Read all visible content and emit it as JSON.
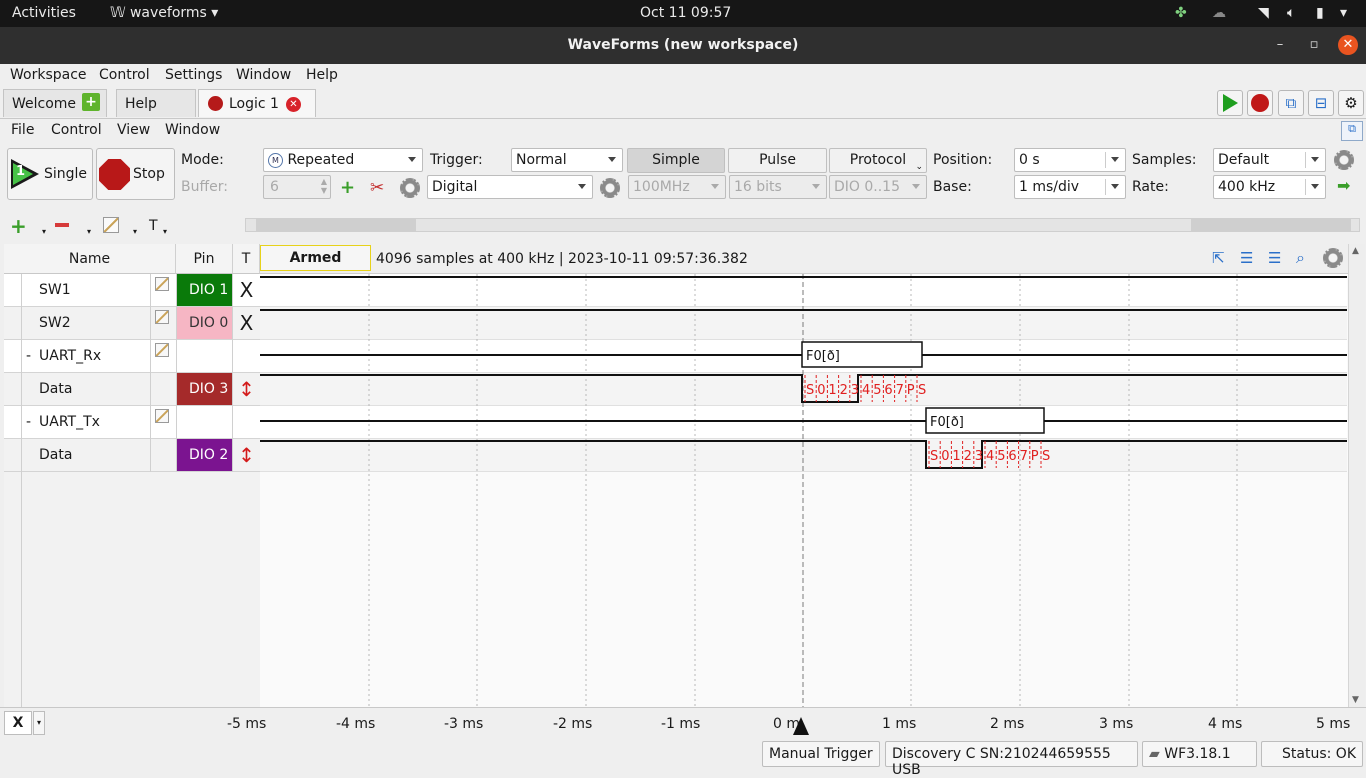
{
  "system_bar": {
    "activities": "Activities",
    "app": "waveforms",
    "clock": "Oct 11  09:57"
  },
  "window": {
    "title": "WaveForms (new workspace)"
  },
  "menu": [
    "Workspace",
    "Control",
    "Settings",
    "Window",
    "Help"
  ],
  "tabs": {
    "welcome": "Welcome",
    "help": "Help",
    "logic": "Logic 1"
  },
  "submenu": [
    "File",
    "Control",
    "View",
    "Window"
  ],
  "controls": {
    "single": "Single",
    "stop": "Stop",
    "mode_label": "Mode:",
    "mode_value": "Repeated",
    "buffer_label": "Buffer:",
    "buffer_value": "6",
    "trigger_label": "Trigger:",
    "trigger_value": "Normal",
    "trigger_source": "Digital",
    "simple": "Simple",
    "pulse": "Pulse",
    "protocol": "Protocol",
    "freq": "100MHz",
    "bits": "16 bits",
    "dio_range": "DIO 0..15",
    "position_label": "Position:",
    "position_value": "0 s",
    "base_label": "Base:",
    "base_value": "1 ms/div",
    "samples_label": "Samples:",
    "samples_value": "Default",
    "rate_label": "Rate:",
    "rate_value": "400 kHz",
    "t_label": "T"
  },
  "table": {
    "headers": {
      "name": "Name",
      "pin": "Pin",
      "t": "T"
    },
    "rows": [
      {
        "name": "SW1",
        "pin": "DIO  1",
        "t": "X",
        "color": "#0a7a0a",
        "text": "#ffffff"
      },
      {
        "name": "SW2",
        "pin": "DIO  0",
        "t": "X",
        "color": "#f6b6c4",
        "text": "#333333"
      },
      {
        "name": "UART_Rx",
        "pin": "",
        "t": "",
        "color": "",
        "text": "",
        "dash": "-"
      },
      {
        "name": "Data",
        "pin": "DIO  3",
        "t": "↕",
        "color": "#a52a2a",
        "text": "#ffffff"
      },
      {
        "name": "UART_Tx",
        "pin": "",
        "t": "",
        "color": "",
        "text": "",
        "dash": "-"
      },
      {
        "name": "Data",
        "pin": "DIO  2",
        "t": "↕",
        "color": "#7b1490",
        "text": "#ffffff"
      }
    ]
  },
  "plot": {
    "status": "Armed",
    "info": "4096 samples at 400 kHz | 2023-10-11 09:57:36.382",
    "rx_frame": "F0[ð]",
    "tx_frame": "F0[ð]",
    "bits": [
      "S",
      "0",
      "1",
      "2",
      "3",
      "4",
      "5",
      "6",
      "7",
      "P",
      "S"
    ],
    "time_ticks": [
      "-5 ms",
      "-4 ms",
      "-3 ms",
      "-2 ms",
      "-1 ms",
      "0 m",
      "1 ms",
      "2 ms",
      "3 ms",
      "4 ms",
      "5 ms"
    ]
  },
  "bottom": {
    "x_button": "X"
  },
  "status": {
    "manual_trigger": "Manual Trigger",
    "device": "Discovery C SN:210244659555 USB",
    "version": "WF3.18.1",
    "state": "Status: OK"
  }
}
